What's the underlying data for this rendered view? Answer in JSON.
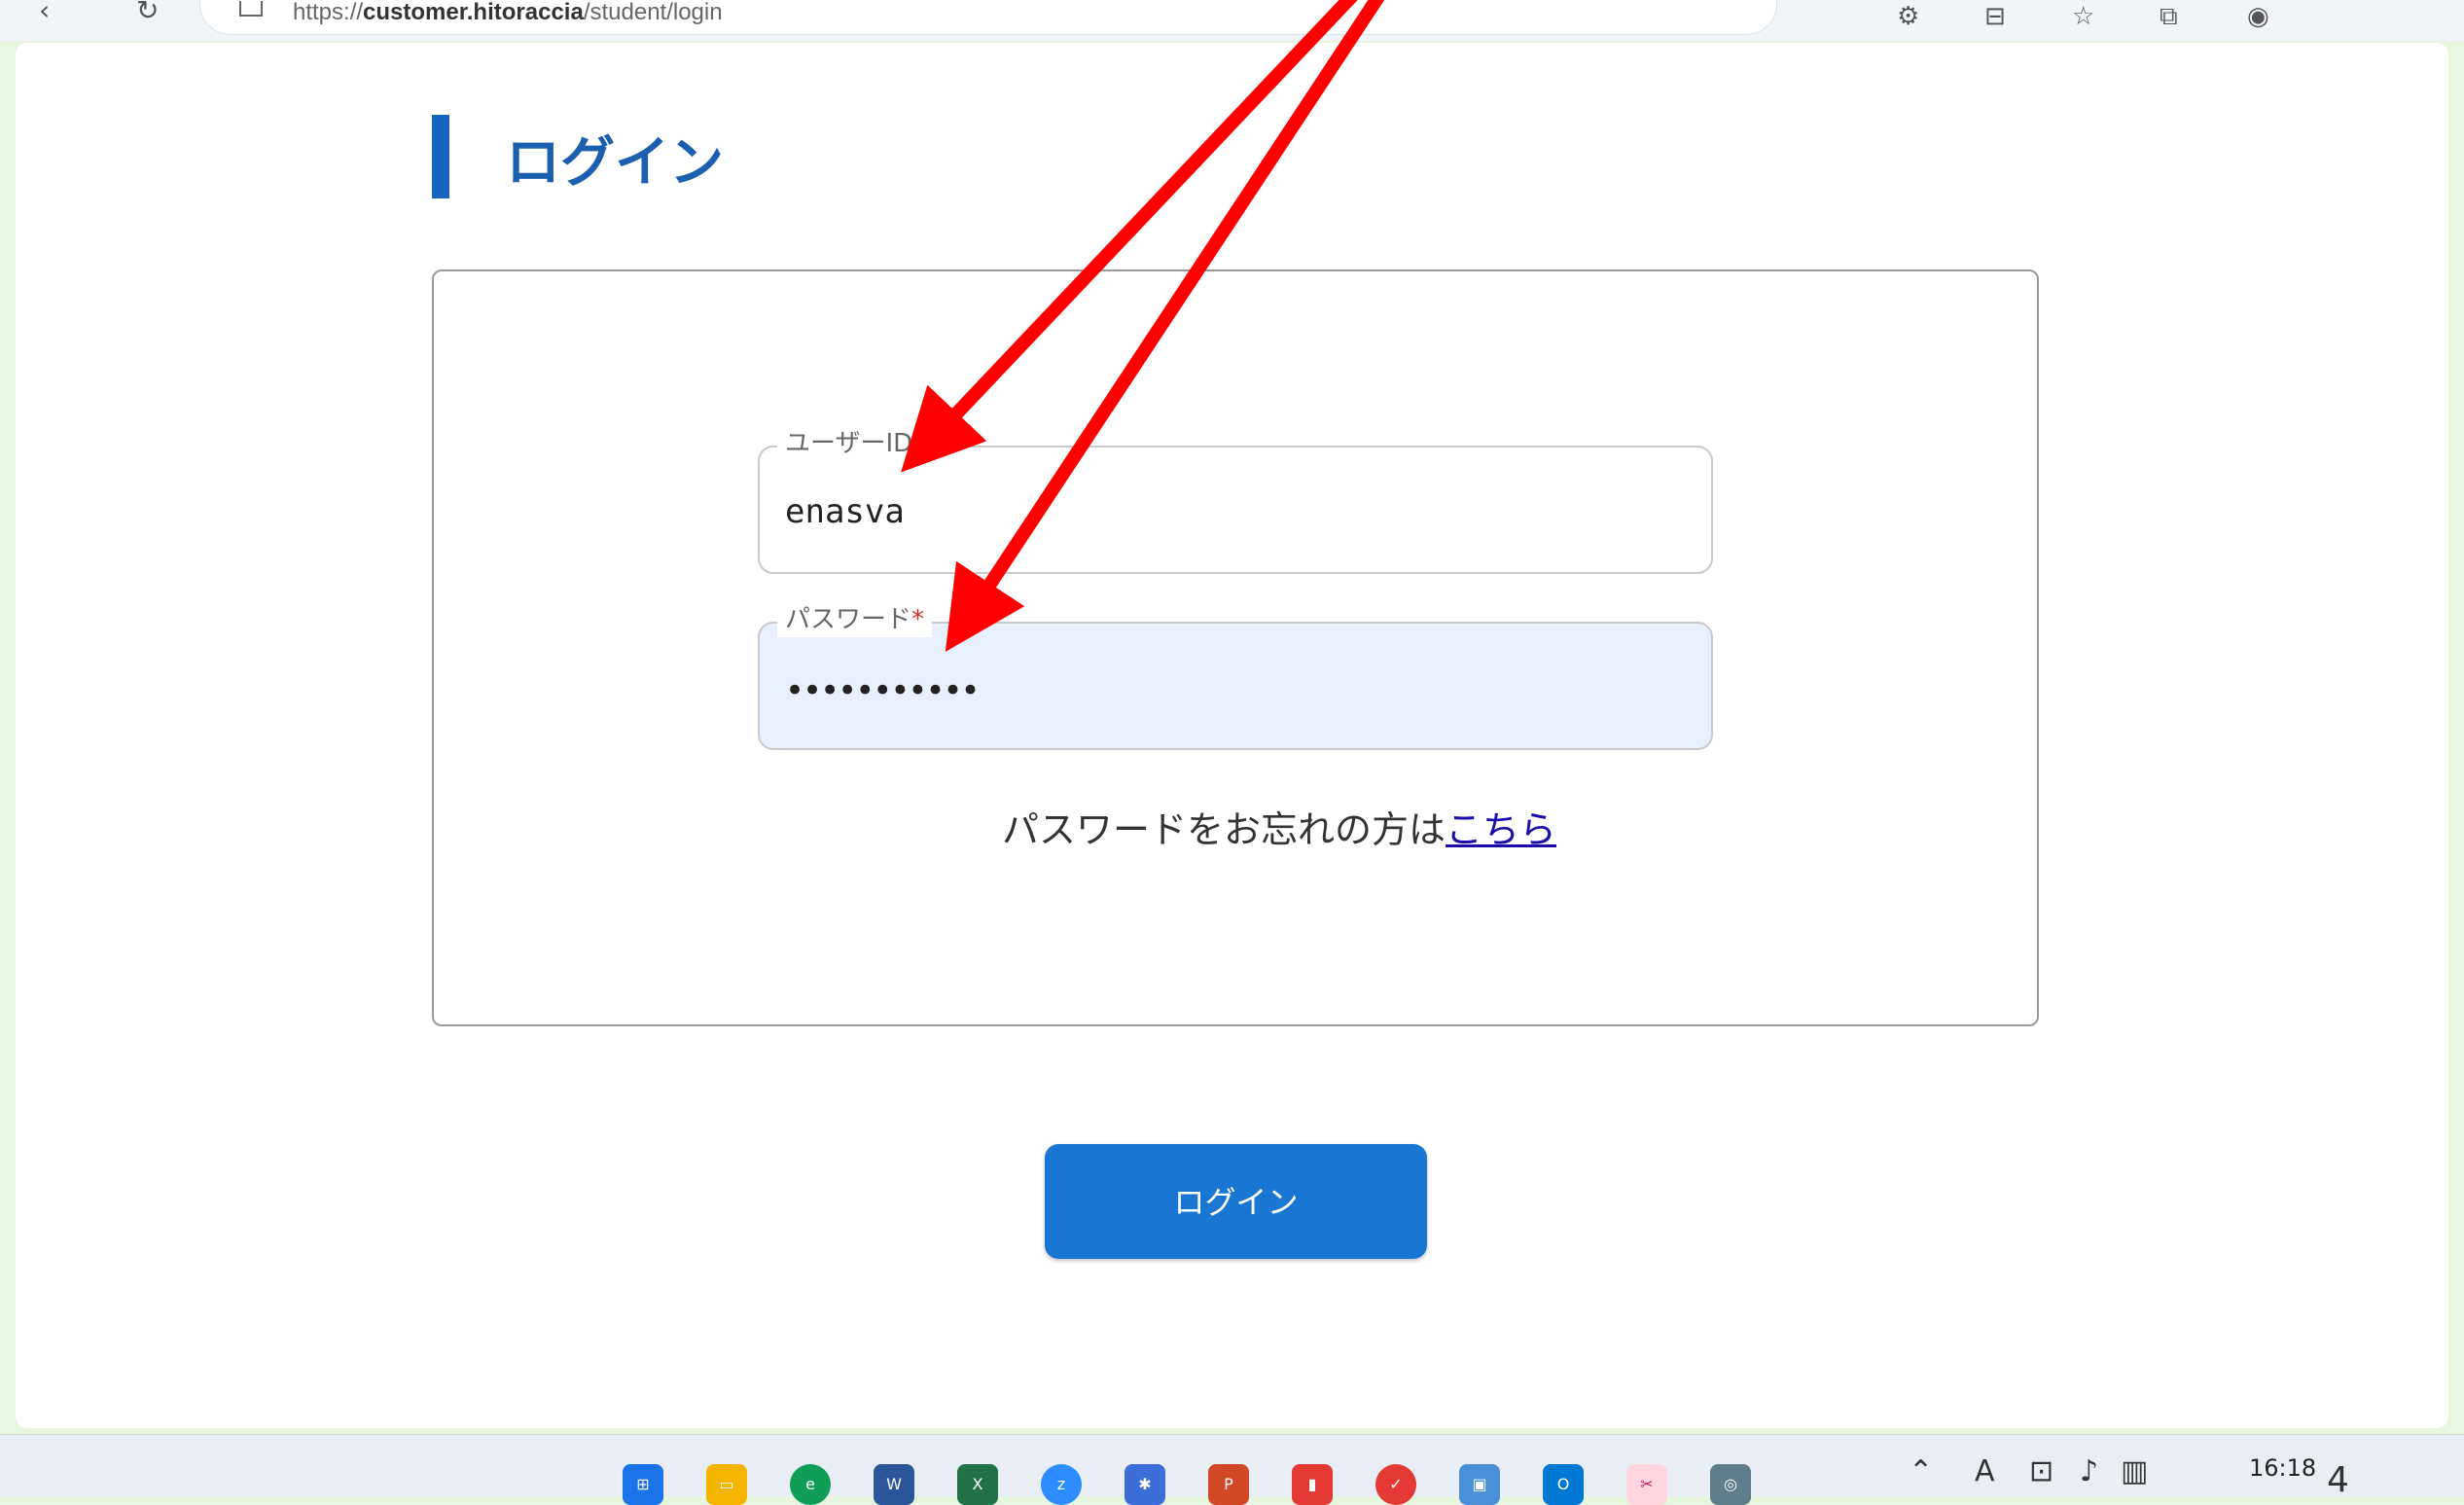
{
  "browser": {
    "url_prefix": "https://",
    "url_host": "customer.hitoraccia",
    "url_path": "/student/login"
  },
  "page": {
    "title": "ログイン",
    "user_id_label": "ユーザーID",
    "password_label": "パスワード",
    "required_mark": "*",
    "user_id_value": "enasva",
    "password_value": "•••••••••••",
    "forgot_text": "パスワードをお忘れの方は",
    "forgot_link": "こちら",
    "login_button": "ログイン"
  },
  "taskbar": {
    "clock": "16:18",
    "notification_count": "4"
  },
  "colors": {
    "accent": "#1976d2",
    "title": "#1b5fae",
    "arrow": "#ff0000",
    "background": "#e6f6df"
  }
}
